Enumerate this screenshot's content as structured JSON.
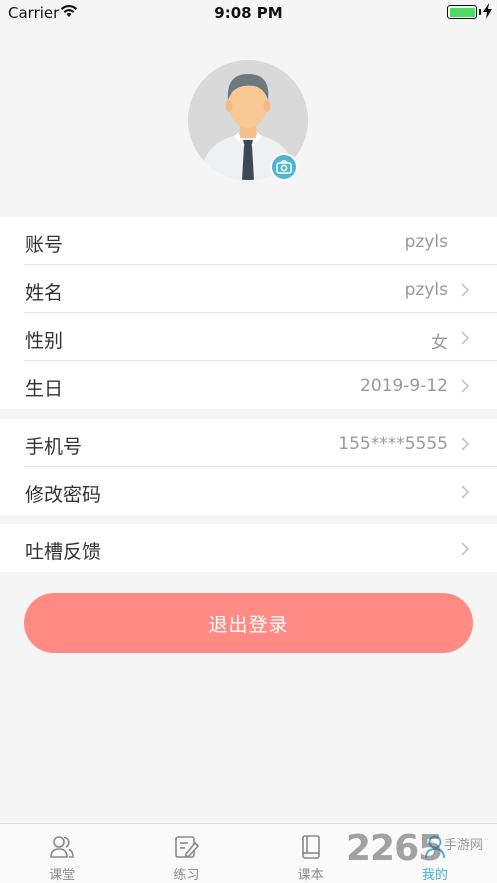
{
  "status_bar": {
    "carrier": "Carrier",
    "time": "9:08 PM",
    "battery_level": 1.0
  },
  "profile": {
    "avatar_icon": "user-avatar",
    "camera_icon": "camera-icon"
  },
  "account_group": [
    {
      "label": "账号",
      "value": "pzyls",
      "chevron": false
    },
    {
      "label": "姓名",
      "value": "pzyls",
      "chevron": true
    },
    {
      "label": "性别",
      "value": "女",
      "chevron": true
    },
    {
      "label": "生日",
      "value": "2019-9-12",
      "chevron": true
    }
  ],
  "security_group": [
    {
      "label": "手机号",
      "value": "155****5555",
      "chevron": true
    },
    {
      "label": "修改密码",
      "value": "",
      "chevron": true
    }
  ],
  "feedback_group": [
    {
      "label": "吐槽反馈",
      "value": "",
      "chevron": true
    }
  ],
  "logout_label": "退出登录",
  "tabs": [
    {
      "label": "课堂",
      "icon": "people-icon",
      "active": false
    },
    {
      "label": "练习",
      "icon": "edit-icon",
      "active": false
    },
    {
      "label": "课本",
      "icon": "book-icon",
      "active": false
    },
    {
      "label": "我的",
      "icon": "person-icon",
      "active": true
    }
  ],
  "watermark": {
    "number": "2265",
    "site": "手游网"
  },
  "colors": {
    "accent": "#3fb0d8",
    "logout": "#ff8b84",
    "camera_badge": "#4fb6d2",
    "battery": "#4cd964"
  }
}
